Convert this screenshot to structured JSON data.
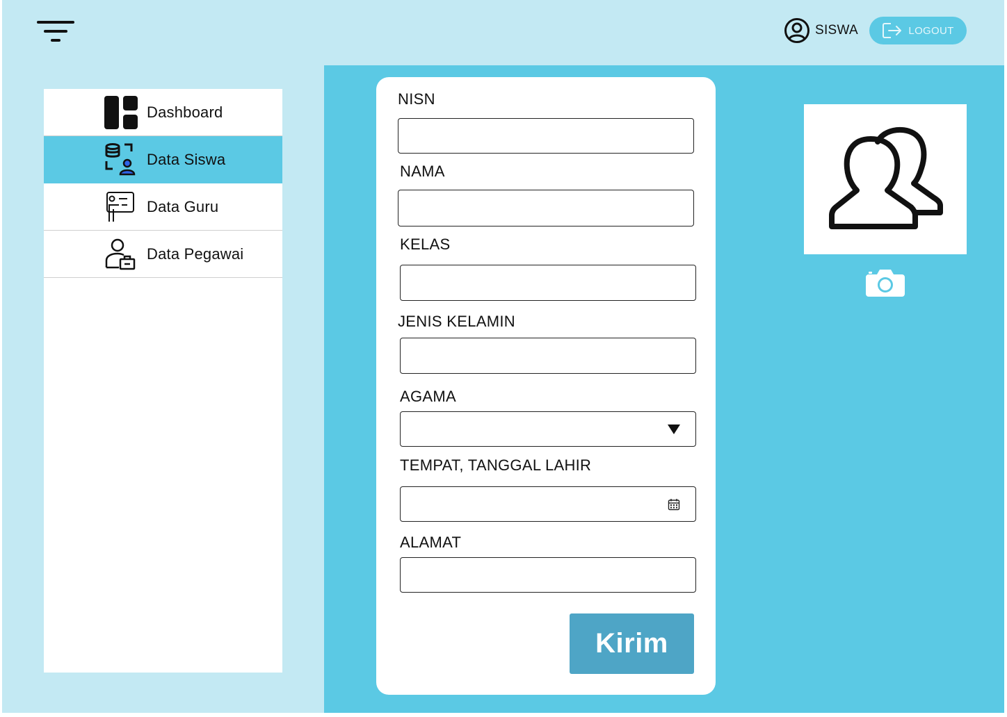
{
  "header": {
    "user_label": "SISWA",
    "logout_label": "LOGOUT"
  },
  "sidebar": {
    "items": [
      {
        "label": "Dashboard",
        "icon": "dashboard-icon",
        "active": false
      },
      {
        "label": "Data Siswa",
        "icon": "student-data-icon",
        "active": true
      },
      {
        "label": "Data Guru",
        "icon": "teacher-icon",
        "active": false
      },
      {
        "label": "Data Pegawai",
        "icon": "employee-icon",
        "active": false
      }
    ]
  },
  "form": {
    "fields": [
      {
        "label": "NISN",
        "type": "text",
        "value": ""
      },
      {
        "label": "NAMA",
        "type": "text",
        "value": ""
      },
      {
        "label": "KELAS",
        "type": "text",
        "value": ""
      },
      {
        "label": "JENIS KELAMIN",
        "type": "text",
        "value": ""
      },
      {
        "label": "AGAMA",
        "type": "select",
        "value": ""
      },
      {
        "label": "TEMPAT, TANGGAL LAHIR",
        "type": "date",
        "value": ""
      },
      {
        "label": "ALAMAT",
        "type": "text",
        "value": ""
      }
    ],
    "submit_label": "Kirim"
  },
  "photo": {
    "placeholder_icon": "users-icon",
    "upload_icon": "camera-icon"
  },
  "colors": {
    "background": "#c3e9f3",
    "accent": "#5bc9e4",
    "button": "#4ea5c6",
    "student_icon_accent": "#2f63e8"
  }
}
